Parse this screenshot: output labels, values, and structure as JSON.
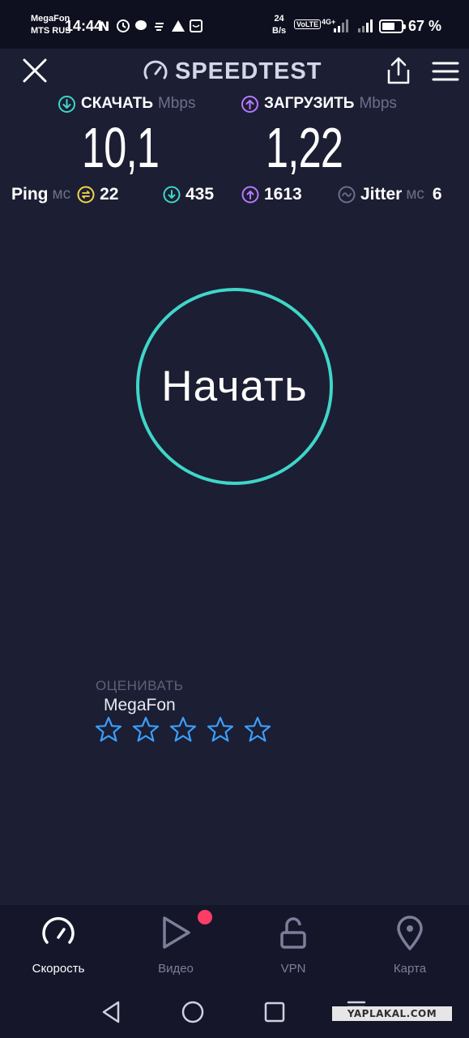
{
  "status_bar": {
    "carrier_1": "MegaFon",
    "carrier_2": "MTS RUS",
    "time": "14:44",
    "net_speed_value": "24",
    "net_speed_unit": "B/s",
    "volte": "VoLTE",
    "network_type": "4G+",
    "battery_level": 0.67,
    "battery_percent": "67 %"
  },
  "header": {
    "app_title": "SPEEDTEST",
    "close_icon": "close-icon",
    "share_icon": "share-icon",
    "menu_icon": "hamburger-menu-icon"
  },
  "download": {
    "label": "СКАЧАТЬ",
    "unit": "Mbps",
    "value": "10,1",
    "color": "#3fd6c8"
  },
  "upload": {
    "label": "ЗАГРУЗИТЬ",
    "unit": "Mbps",
    "value": "1,22",
    "color": "#b779ff"
  },
  "latency": {
    "ping_label": "Ping",
    "ping_unit": "мс",
    "ping_idle": "22",
    "ping_download": "435",
    "ping_upload": "1613",
    "jitter_label": "Jitter",
    "jitter_unit": "мс",
    "jitter_value": "6"
  },
  "start_button": {
    "label": "Начать",
    "accent": "#3fd6c8"
  },
  "rating": {
    "title": "ОЦЕНИВАТЬ",
    "provider": "MegaFon",
    "star_count": 5,
    "filled": 0,
    "star_color": "#3aa0ff"
  },
  "bottom_nav": {
    "items": [
      {
        "label": "Скорость",
        "icon": "speedometer-icon",
        "active": true
      },
      {
        "label": "Видео",
        "icon": "play-icon",
        "active": false
      },
      {
        "label": "VPN",
        "icon": "unlock-icon",
        "active": false
      },
      {
        "label": "Карта",
        "icon": "map-pin-icon",
        "active": false
      }
    ]
  },
  "watermark": "YAPLAKAL.COM"
}
